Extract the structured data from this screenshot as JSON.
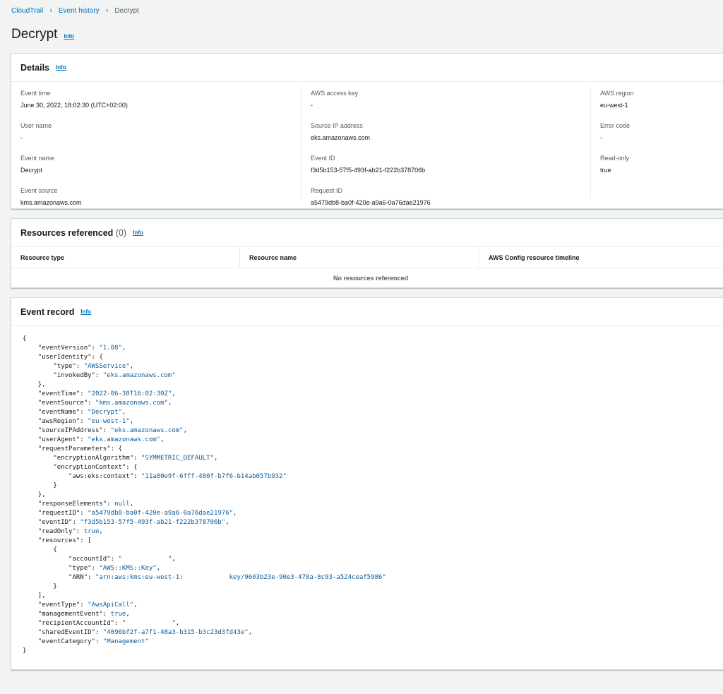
{
  "breadcrumb": {
    "items": [
      "CloudTrail",
      "Event history"
    ],
    "current": "Decrypt"
  },
  "page": {
    "title": "Decrypt",
    "info": "Info"
  },
  "details": {
    "title": "Details",
    "info": "Info",
    "col1": [
      {
        "label": "Event time",
        "value": "June 30, 2022, 18:02:30 (UTC+02:00)"
      },
      {
        "label": "User name",
        "value": "-"
      },
      {
        "label": "Event name",
        "value": "Decrypt"
      },
      {
        "label": "Event source",
        "value": "kms.amazonaws.com"
      }
    ],
    "col2": [
      {
        "label": "AWS access key",
        "value": "-"
      },
      {
        "label": "Source IP address",
        "value": "eks.amazonaws.com"
      },
      {
        "label": "Event ID",
        "value": "f3d5b153-57f5-493f-ab21-f222b378706b"
      },
      {
        "label": "Request ID",
        "value": "a5479db8-ba0f-420e-a9a6-0a76dae21976"
      }
    ],
    "col3": [
      {
        "label": "AWS region",
        "value": "eu-west-1"
      },
      {
        "label": "Error code",
        "value": "-"
      },
      {
        "label": "Read-only",
        "value": "true"
      }
    ]
  },
  "resources": {
    "title": "Resources referenced",
    "count": "(0)",
    "info": "Info",
    "columns": [
      "Resource type",
      "Resource name",
      "AWS Config resource timeline"
    ],
    "empty": "No resources referenced"
  },
  "event_record": {
    "title": "Event record",
    "info": "Info",
    "lines": [
      {
        "i": 0,
        "k": "",
        "v": "{"
      },
      {
        "i": 1,
        "k": "\"eventVersion\": ",
        "s": "\"1.08\"",
        "e": ","
      },
      {
        "i": 1,
        "k": "\"userIdentity\": {",
        "s": "",
        "e": ""
      },
      {
        "i": 2,
        "k": "\"type\": ",
        "s": "\"AWSService\"",
        "e": ","
      },
      {
        "i": 2,
        "k": "\"invokedBy\": ",
        "s": "\"eks.amazonaws.com\"",
        "e": ""
      },
      {
        "i": 1,
        "k": "},",
        "s": "",
        "e": ""
      },
      {
        "i": 1,
        "k": "\"eventTime\": ",
        "s": "\"2022-06-30T16:02:30Z\"",
        "e": ","
      },
      {
        "i": 1,
        "k": "\"eventSource\": ",
        "s": "\"kms.amazonaws.com\"",
        "e": ","
      },
      {
        "i": 1,
        "k": "\"eventName\": ",
        "s": "\"Decrypt\"",
        "e": ","
      },
      {
        "i": 1,
        "k": "\"awsRegion\": ",
        "s": "\"eu-west-1\"",
        "e": ","
      },
      {
        "i": 1,
        "k": "\"sourceIPAddress\": ",
        "s": "\"eks.amazonaws.com\"",
        "e": ","
      },
      {
        "i": 1,
        "k": "\"userAgent\": ",
        "s": "\"eks.amazonaws.com\"",
        "e": ","
      },
      {
        "i": 1,
        "k": "\"requestParameters\": {",
        "s": "",
        "e": ""
      },
      {
        "i": 2,
        "k": "\"encryptionAlgorithm\": ",
        "s": "\"SYMMETRIC_DEFAULT\"",
        "e": ","
      },
      {
        "i": 2,
        "k": "\"encryptionContext\": {",
        "s": "",
        "e": ""
      },
      {
        "i": 3,
        "k": "\"aws:eks:context\": ",
        "s": "\"11a80e9f-6fff-480f-b7f6-b14ab057b932\"",
        "e": ""
      },
      {
        "i": 2,
        "k": "}",
        "s": "",
        "e": ""
      },
      {
        "i": 1,
        "k": "},",
        "s": "",
        "e": ""
      },
      {
        "i": 1,
        "k": "\"responseElements\": ",
        "s": "null",
        "e": ","
      },
      {
        "i": 1,
        "k": "\"requestID\": ",
        "s": "\"a5479db8-ba0f-420e-a9a6-0a76dae21976\"",
        "e": ","
      },
      {
        "i": 1,
        "k": "\"eventID\": ",
        "s": "\"f3d5b153-57f5-493f-ab21-f222b378706b\"",
        "e": ","
      },
      {
        "i": 1,
        "k": "\"readOnly\": ",
        "s": "true",
        "e": ","
      },
      {
        "i": 1,
        "k": "\"resources\": [",
        "s": "",
        "e": ""
      },
      {
        "i": 2,
        "k": "{",
        "s": "",
        "e": ""
      },
      {
        "i": 3,
        "k": "\"accountId\": ",
        "s": "\"            \"",
        "e": ","
      },
      {
        "i": 3,
        "k": "\"type\": ",
        "s": "\"AWS::KMS::Key\"",
        "e": ","
      },
      {
        "i": 3,
        "k": "\"ARN\": ",
        "s": "\"arn:aws:kms:eu-west-1:            key/9603b23e-90e3-478a-8c93-a524ceaf5986\"",
        "e": ""
      },
      {
        "i": 2,
        "k": "}",
        "s": "",
        "e": ""
      },
      {
        "i": 1,
        "k": "],",
        "s": "",
        "e": ""
      },
      {
        "i": 1,
        "k": "\"eventType\": ",
        "s": "\"AwsApiCall\"",
        "e": ","
      },
      {
        "i": 1,
        "k": "\"managementEvent\": ",
        "s": "true",
        "e": ","
      },
      {
        "i": 1,
        "k": "\"recipientAccountId\": ",
        "s": "\"            \"",
        "e": ","
      },
      {
        "i": 1,
        "k": "\"sharedEventID\": ",
        "s": "\"4096bf2f-a7f1-48a3-b315-b3c23d3fd43e\"",
        "e": ","
      },
      {
        "i": 1,
        "k": "\"eventCategory\": ",
        "s": "\"Management\"",
        "e": ""
      },
      {
        "i": 0,
        "k": "",
        "v": "}"
      }
    ]
  }
}
